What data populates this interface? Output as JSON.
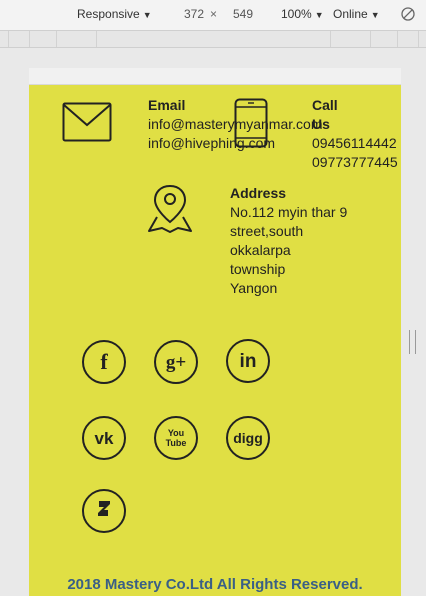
{
  "devtools": {
    "device": "Responsive",
    "width": "372",
    "separator": "×",
    "height": "549",
    "zoom": "100%",
    "network": "Online"
  },
  "contact": {
    "email_label": "Email",
    "email_1": "info@masterymyanmar.com",
    "email_2": "info@hivephing.com",
    "call_label_1": "Call",
    "call_label_2": "Us",
    "phone_1": "09456114442",
    "phone_2": "09773777445",
    "address_label": "Address",
    "address_lines": [
      "No.112 myin thar 9",
      "street,south",
      "okkalarpa",
      "township",
      "Yangon"
    ]
  },
  "social": {
    "facebook": "f",
    "googleplus": "g+",
    "linkedin": "in",
    "vk": "vk",
    "youtube": "You Tube",
    "digg": "digg",
    "deviantart": "deviantart-icon"
  },
  "footer": {
    "copyright": "2018 Mastery Co.Ltd All Rights Reserved."
  },
  "colors": {
    "page_background": "#e0df44",
    "footer_text": "#3a5f86",
    "icon_stroke": "#222222"
  }
}
